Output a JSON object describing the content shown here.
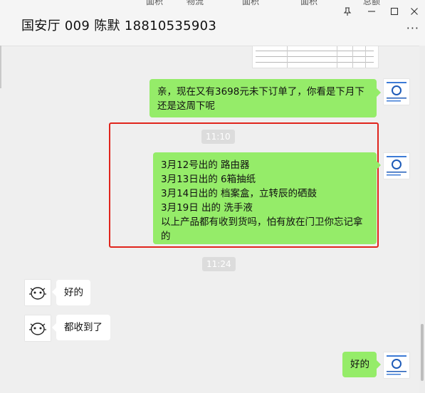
{
  "window": {
    "title": "国安厅 009  陈默 18810535903",
    "top_cut_tabs": [
      "面积",
      "物流",
      "面积",
      "面积",
      "总额"
    ],
    "controls": {
      "pin": "⊥",
      "minimize": "—",
      "maximize": "☐",
      "close": "✕"
    },
    "more": "···"
  },
  "messages": [
    {
      "type": "image-doc",
      "side": "me"
    },
    {
      "type": "text",
      "side": "me",
      "lines": [
        "亲，现在又有3698元未下订单了，你看是下月下",
        "还是这周下呢"
      ]
    },
    {
      "type": "time",
      "text": "11:10"
    },
    {
      "type": "text",
      "side": "me",
      "lines": [
        "3月12号出的 路由器",
        "3月13日出的 6箱抽纸",
        "3月14日出的 档案盒，立转辰的硒鼓",
        "3月19日 出的 洗手液",
        "以上产品都有收到货吗，怕有放在门卫你忘记拿",
        "的"
      ]
    },
    {
      "type": "time",
      "text": "11:24"
    },
    {
      "type": "text",
      "side": "other",
      "lines": [
        "好的"
      ]
    },
    {
      "type": "text",
      "side": "other",
      "lines": [
        "都收到了"
      ]
    },
    {
      "type": "text",
      "side": "me",
      "lines": [
        "好的"
      ]
    }
  ],
  "colors": {
    "me_bubble": "#95ec69",
    "other_bubble": "#ffffff",
    "highlight": "#e0241c",
    "background": "#efefef"
  }
}
